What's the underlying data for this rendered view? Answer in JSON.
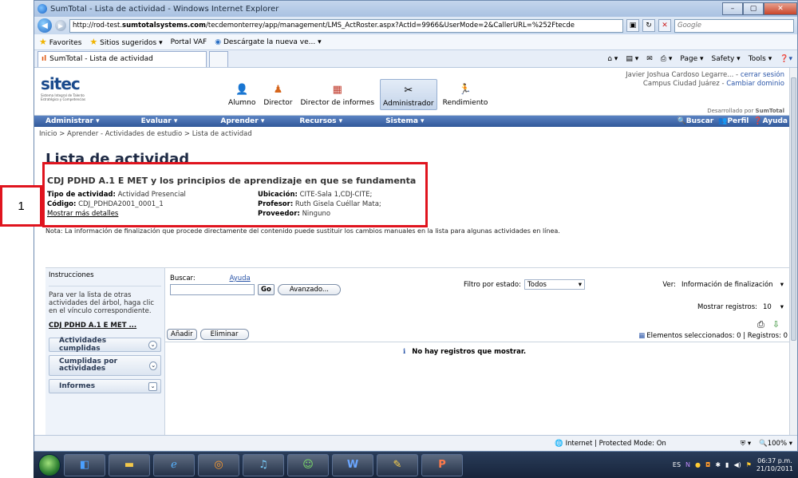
{
  "window": {
    "title": "SumTotal - Lista de actividad - Windows Internet Explorer",
    "url_prefix": "http://rod-test.",
    "url_bold": "sumtotalsystems.com",
    "url_suffix": "/tecdemonterrey/app/management/LMS_ActRoster.aspx?ActId=9966&UserMode=2&CallerURL=%252Ftecde",
    "search_placeholder": "Google"
  },
  "favorites": {
    "favorites_label": "Favorites",
    "suggested_label": "Sitios sugeridos ▾",
    "portal_label": "Portal VAF",
    "download_label": "Descárgate la nueva ve... ▾"
  },
  "tab": {
    "label": "SumTotal - Lista de actividad",
    "commands": [
      "Page ▾",
      "Safety ▾",
      "Tools ▾"
    ]
  },
  "header": {
    "logo_text": "sitec",
    "logo_sub": "Sistema Integral de Talento Estratégico y Competencias",
    "roles": [
      "Alumno",
      "Director",
      "Director de informes",
      "Administrador",
      "Rendimiento"
    ],
    "user_line": "Javier Joshua Cardoso Legarre... - ",
    "logout": "cerrar sesión",
    "campus_line": "Campus Ciudad Juárez - ",
    "change_domain": "Cambiar dominio",
    "powered_prefix": "Desarrollado por ",
    "powered_brand": "SumTotal"
  },
  "mainnav": {
    "items": [
      "Administrar ▾",
      "Evaluar ▾",
      "Aprender ▾",
      "Recursos ▾",
      "Sistema ▾"
    ],
    "search": "Buscar",
    "profile": "Perfil",
    "help": "Ayuda"
  },
  "breadcrumb": "Inicio > Aprender - Actividades de estudio > Lista de actividad",
  "page_title": "Lista de actividad",
  "activity": {
    "title": "CDJ PDHD A.1 E MET y los principios de aprendizaje en que se fundamenta",
    "type_label": "Tipo de actividad:",
    "type_value": "Actividad Presencial",
    "location_label": "Ubicación:",
    "location_value": "CITE-Sala 1,CDJ-CITE;",
    "code_label": "Código:",
    "code_value": "CDJ_PDHDA2001_0001_1",
    "teacher_label": "Profesor:",
    "teacher_value": "Ruth Gisela Cuéllar Mata;",
    "more_details": "Mostrar más detalles",
    "provider_label": "Proveedor:",
    "provider_value": "Ninguno"
  },
  "callout_number": "1",
  "note": "Nota: La información de finalización que procede directamente del contenido puede sustituir los cambios manuales en la lista para algunas actividades en línea.",
  "left_panel": {
    "instructions_label": "Instrucciones",
    "instructions_text": "Para ver la lista de otras actividades del árbol, haga clic en el vínculo correspondiente.",
    "activity_link": "CDJ PDHD A.1 E MET ...",
    "accordions": [
      "Actividades cumplidas",
      "Cumplidas por actividades",
      "Informes"
    ]
  },
  "roster": {
    "search_label": "Buscar:",
    "help_link": "Ayuda",
    "go": "Go",
    "advanced": "Avanzado...",
    "status_filter_label": "Filtro por estado:",
    "status_filter_value": "Todos",
    "view_label": "Ver:",
    "view_value": "Información de finalización",
    "show_records_label": "Mostrar registros:",
    "show_records_value": "10",
    "add": "Añadir",
    "remove": "Eliminar",
    "selected_text": "Elementos seleccionados: 0 | Registros: 0",
    "empty": "No hay registros que mostrar."
  },
  "statusbar": {
    "zone": "Internet | Protected Mode: On",
    "zoom": "100%"
  },
  "taskbar": {
    "lang": "ES",
    "time": "06:37 p.m.",
    "date": "21/10/2011"
  }
}
